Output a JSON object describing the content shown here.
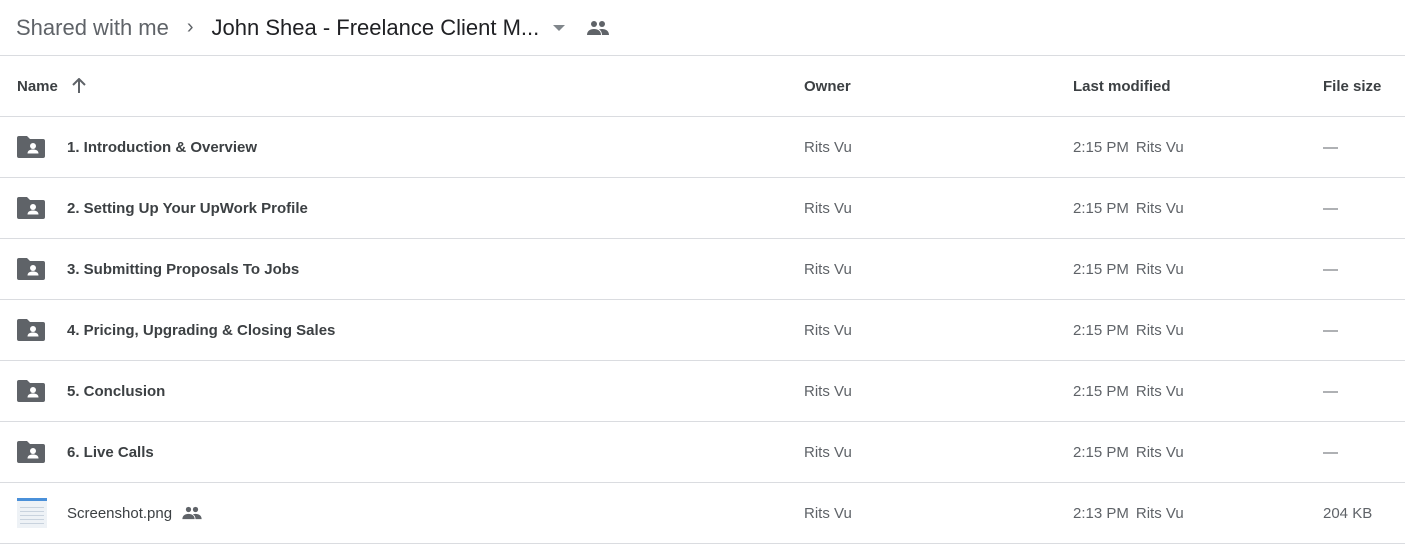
{
  "breadcrumb": {
    "root": "Shared with me",
    "separator": "›",
    "current": "John Shea - Freelance Client M...",
    "current_icons": [
      "chevron-down-icon",
      "shared-people-icon"
    ]
  },
  "table": {
    "headers": {
      "name": "Name",
      "sort_icon": "arrow-up-icon",
      "owner": "Owner",
      "last_modified": "Last modified",
      "file_size": "File size"
    },
    "rows": [
      {
        "icon": "shared-folder-icon",
        "name": "1. Introduction & Overview",
        "owner": "Rits Vu",
        "modified_time": "2:15 PM",
        "modified_by": "Rits Vu",
        "size": "—"
      },
      {
        "icon": "shared-folder-icon",
        "name": "2. Setting Up Your UpWork Profile",
        "owner": "Rits Vu",
        "modified_time": "2:15 PM",
        "modified_by": "Rits Vu",
        "size": "—"
      },
      {
        "icon": "shared-folder-icon",
        "name": "3. Submitting Proposals To Jobs",
        "owner": "Rits Vu",
        "modified_time": "2:15 PM",
        "modified_by": "Rits Vu",
        "size": "—"
      },
      {
        "icon": "shared-folder-icon",
        "name": "4. Pricing, Upgrading & Closing Sales",
        "owner": "Rits Vu",
        "modified_time": "2:15 PM",
        "modified_by": "Rits Vu",
        "size": "—"
      },
      {
        "icon": "shared-folder-icon",
        "name": "5. Conclusion",
        "owner": "Rits Vu",
        "modified_time": "2:15 PM",
        "modified_by": "Rits Vu",
        "size": "—"
      },
      {
        "icon": "shared-folder-icon",
        "name": "6. Live Calls",
        "owner": "Rits Vu",
        "modified_time": "2:15 PM",
        "modified_by": "Rits Vu",
        "size": "—"
      },
      {
        "icon": "image-thumbnail-icon",
        "name": "Screenshot.png",
        "shared": true,
        "owner": "Rits Vu",
        "modified_time": "2:13 PM",
        "modified_by": "Rits Vu",
        "size": "204 KB"
      }
    ]
  }
}
